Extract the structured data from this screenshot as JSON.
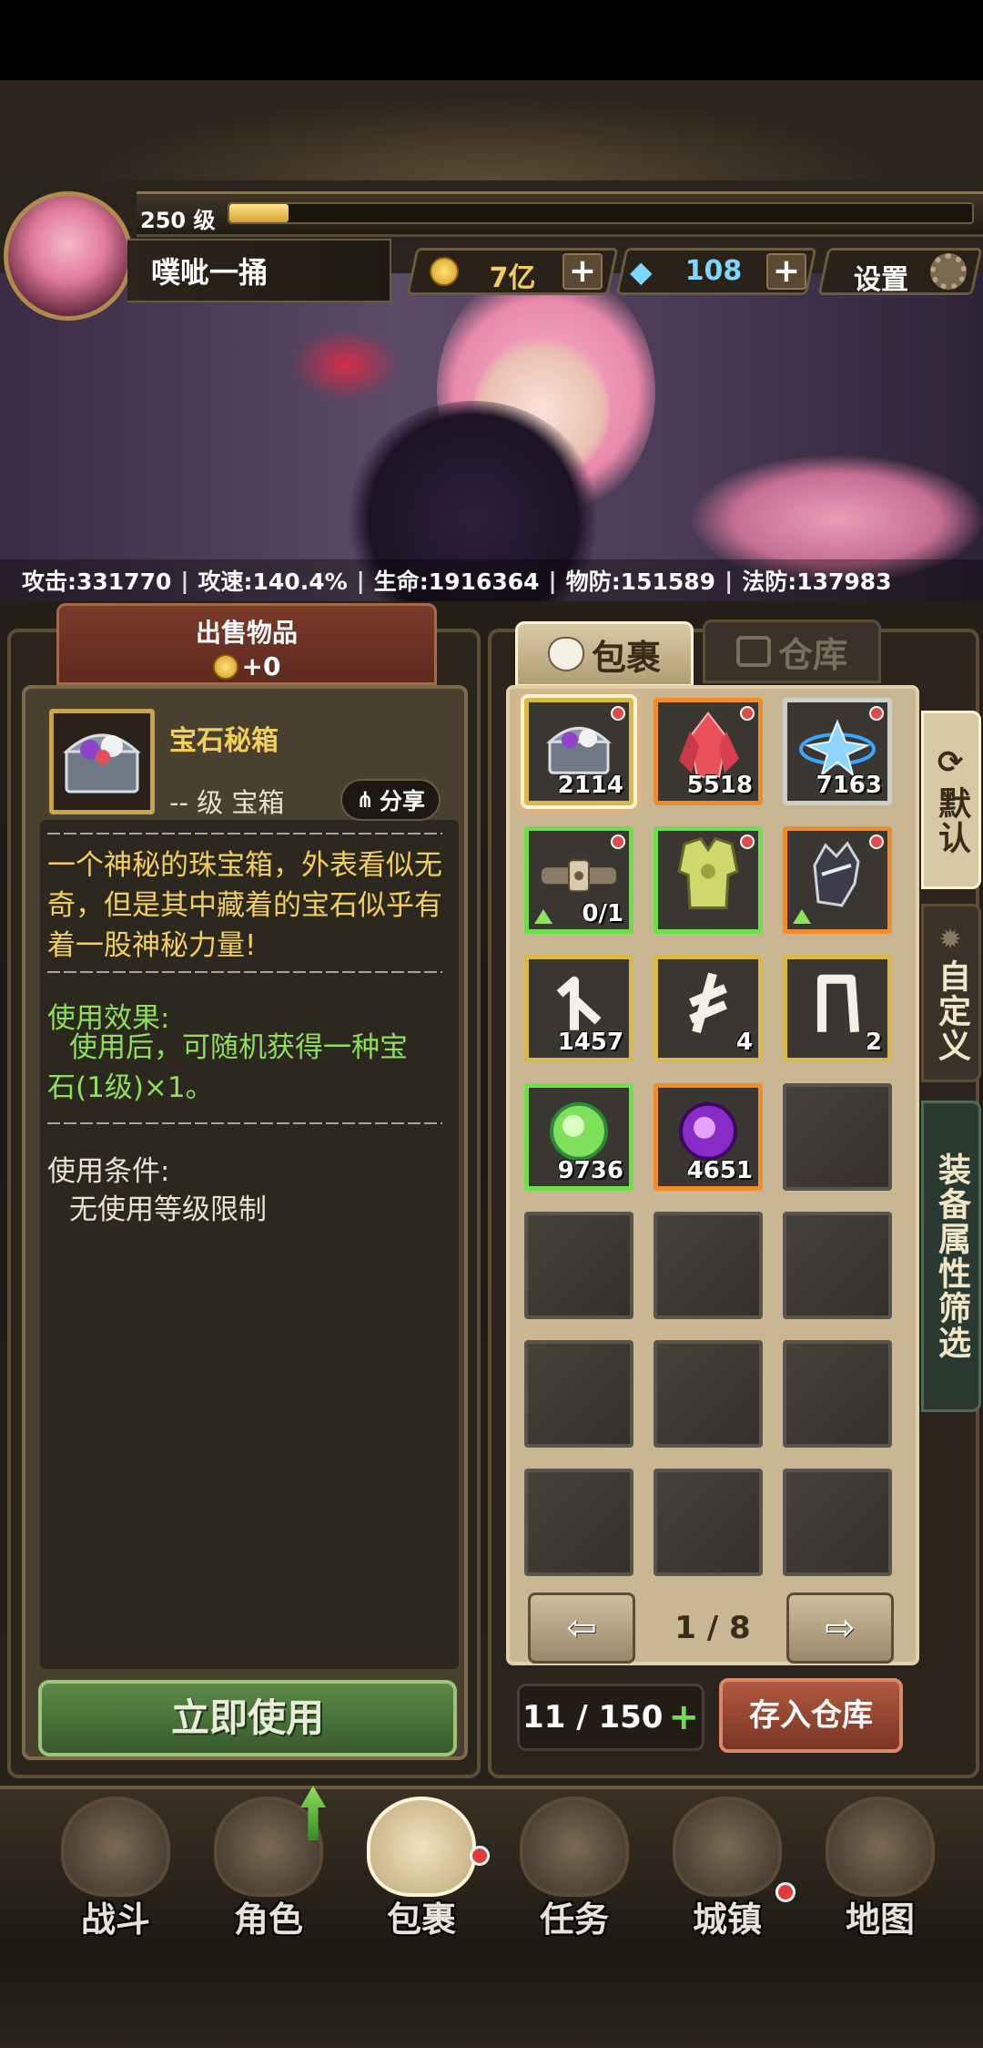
{
  "player": {
    "level": "250 级",
    "name": "噗呲一捅",
    "xp_fraction": 0.08
  },
  "currency": {
    "gold": "7亿",
    "gems": "108",
    "settings_label": "设置"
  },
  "stats": [
    {
      "label": "攻击:331770"
    },
    {
      "label": "攻速:140.4%"
    },
    {
      "label": "生命:1916364"
    },
    {
      "label": "物防:151589"
    },
    {
      "label": "法防:137983"
    }
  ],
  "sell": {
    "title": "出售物品",
    "amount": "+0"
  },
  "item": {
    "name": "宝石秘箱",
    "level_type": "-- 级 宝箱",
    "share_label": "分享",
    "description": "一个神秘的珠宝箱，外表看似无奇，但是其中藏着的宝石似乎有着一股神秘力量!",
    "effect_title": "使用效果:",
    "effect_body": "使用后，可随机获得一种宝石(1级)×1。",
    "cond_title": "使用条件:",
    "cond_body": "无使用等级限制",
    "use_button": "立即使用"
  },
  "tabs": {
    "bag": "包裹",
    "warehouse": "仓库"
  },
  "side_tabs": {
    "default": "默认",
    "custom": "自定义",
    "filter": "装备属性筛选"
  },
  "slots": [
    {
      "count": "2114",
      "quality": "gold",
      "icon": "treasure-chest-icon",
      "dot": true,
      "selected": true
    },
    {
      "count": "5518",
      "quality": "orange",
      "icon": "red-crystal-icon",
      "dot": true
    },
    {
      "count": "7163",
      "quality": "white",
      "icon": "blue-snowflake-icon",
      "dot": true
    },
    {
      "count": "0/1",
      "quality": "green",
      "icon": "belt-icon",
      "dot": true,
      "up": true
    },
    {
      "count": "",
      "quality": "green",
      "icon": "armor-icon",
      "dot": true
    },
    {
      "count": "",
      "quality": "orange",
      "icon": "gauntlet-icon",
      "dot": true,
      "up": true
    },
    {
      "count": "1457",
      "quality": "gold",
      "icon": "rune-icon"
    },
    {
      "count": "4",
      "quality": "gold",
      "icon": "rune-icon"
    },
    {
      "count": "2",
      "quality": "gold",
      "icon": "rune-icon"
    },
    {
      "count": "9736",
      "quality": "green",
      "icon": "green-orb-icon"
    },
    {
      "count": "4651",
      "quality": "orange",
      "icon": "purple-orb-icon"
    },
    {
      "empty": true
    },
    {
      "empty": true
    },
    {
      "empty": true
    },
    {
      "empty": true
    },
    {
      "empty": true
    },
    {
      "empty": true
    },
    {
      "empty": true
    },
    {
      "empty": true
    },
    {
      "empty": true
    },
    {
      "empty": true
    }
  ],
  "pager": {
    "text": "1 / 8"
  },
  "capacity": "11 / 150",
  "store_button": "存入仓库",
  "nav": [
    {
      "label": "战斗",
      "icon": "sword-shield-icon"
    },
    {
      "label": "角色",
      "icon": "helmet-icon"
    },
    {
      "label": "包裹",
      "icon": "backpack-icon",
      "active": true
    },
    {
      "label": "任务",
      "icon": "scroll-icon"
    },
    {
      "label": "城镇",
      "icon": "castle-icon"
    },
    {
      "label": "地图",
      "icon": "map-icon"
    }
  ],
  "colors": {
    "gold_text": "#f2cf5b",
    "gem_text": "#7fd6ff",
    "effect_green": "#8ee05a"
  }
}
